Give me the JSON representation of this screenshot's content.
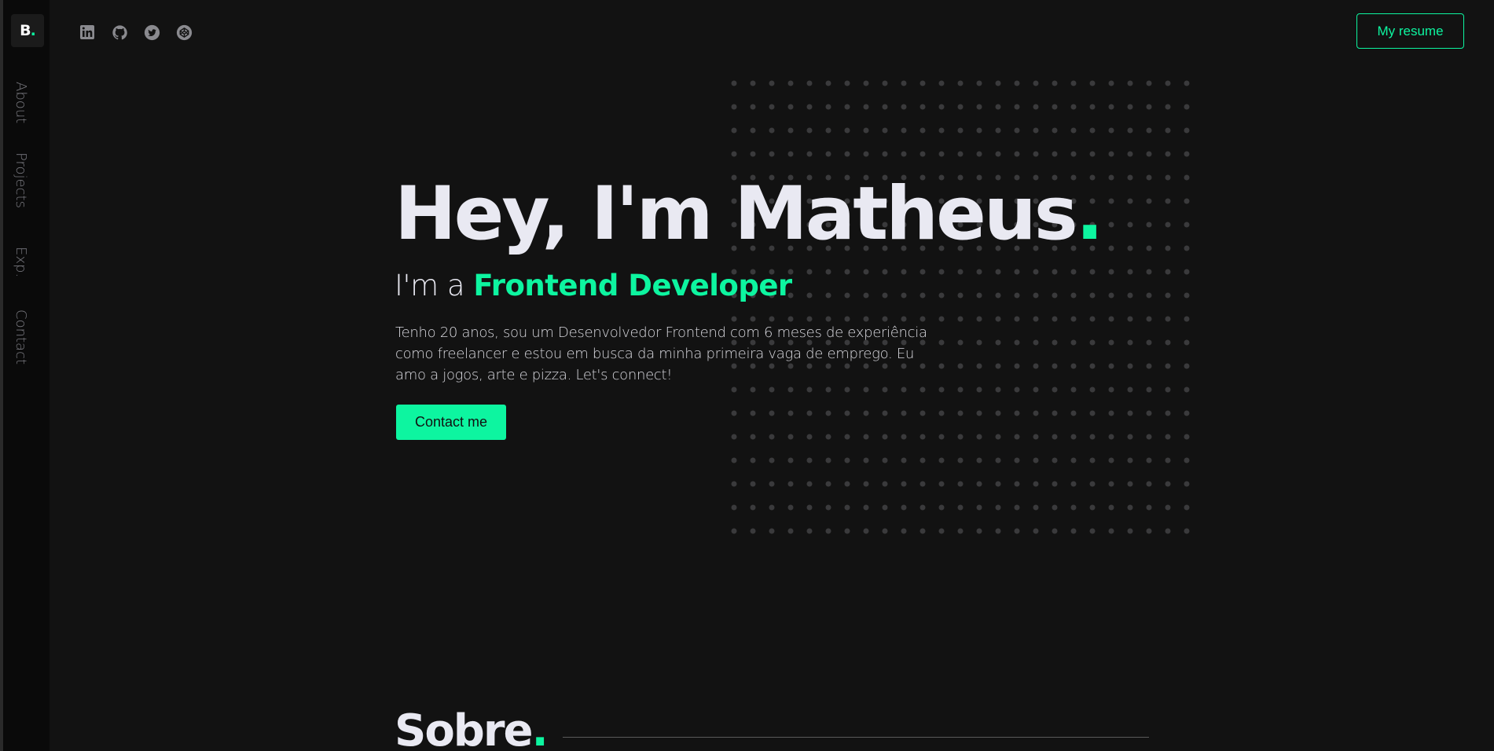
{
  "sidebar": {
    "logo_letter": "B",
    "logo_dot": ".",
    "links": [
      {
        "label": "About"
      },
      {
        "label": "Projects"
      },
      {
        "label": "Exp."
      },
      {
        "label": "Contact"
      }
    ]
  },
  "header": {
    "socials": [
      {
        "icon": "linkedin-icon"
      },
      {
        "icon": "github-icon"
      },
      {
        "icon": "twitter-icon"
      },
      {
        "icon": "codepen-icon"
      }
    ],
    "resume_label": "My resume"
  },
  "hero": {
    "title": "Hey, I'm Matheus",
    "title_dot": ".",
    "subtitle_prefix": "I'm a ",
    "subtitle_role": "Frontend Developer",
    "description": "Tenho 20 anos, sou um Desenvolvedor Frontend com 6 meses de experiência como freelancer e estou em busca da minha primeira vaga de emprego. Eu amo a jogos, arte e pizza. Let's connect!",
    "contact_label": "Contact me"
  },
  "about_section": {
    "title": "Sobre",
    "title_dot": "."
  },
  "colors": {
    "accent": "#0df5a0",
    "background": "#121212",
    "sidebar": "#0a0a0a",
    "text": "#e9e9f2"
  }
}
